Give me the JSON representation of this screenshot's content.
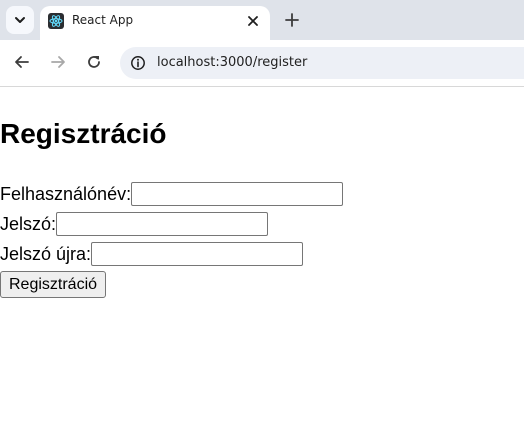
{
  "browser": {
    "tab_title": "React App",
    "url": "localhost:3000/register"
  },
  "page": {
    "title": "Regisztráció",
    "fields": [
      {
        "label": "Felhasználónév:",
        "value": ""
      },
      {
        "label": "Jelszó:",
        "value": ""
      },
      {
        "label": "Jelszó újra:",
        "value": ""
      }
    ],
    "submit_label": "Regisztráció"
  }
}
